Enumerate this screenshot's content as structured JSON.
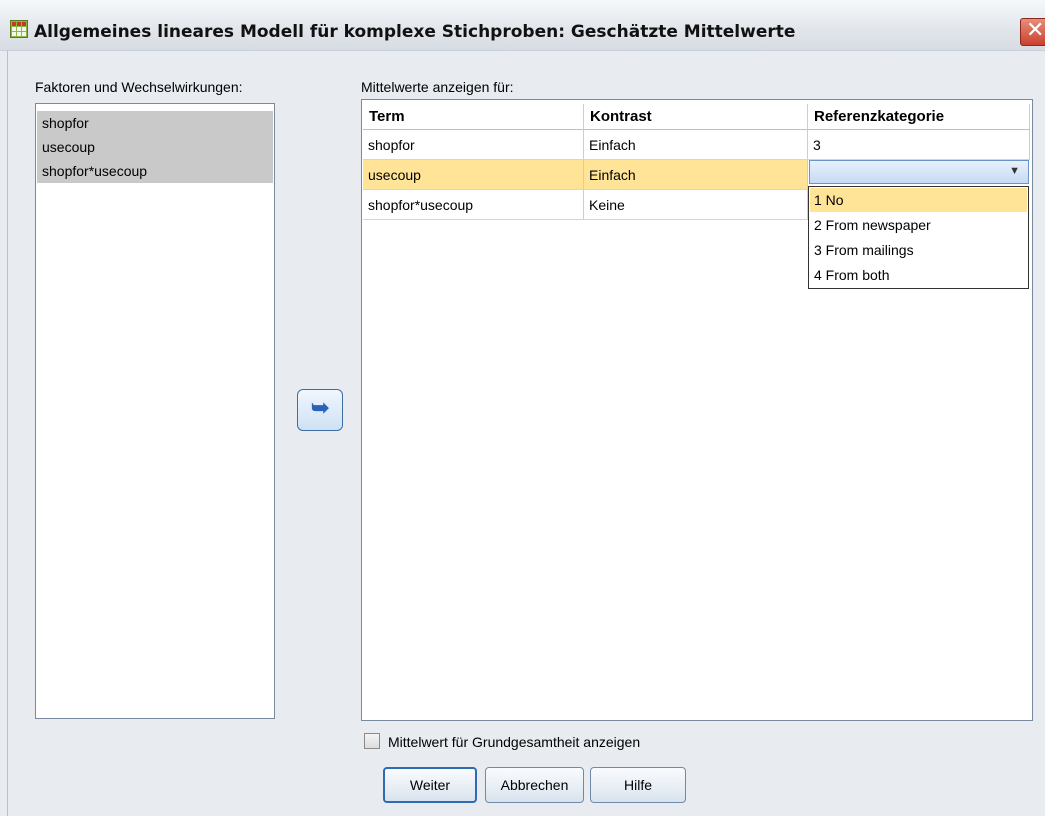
{
  "window": {
    "title": "Allgemeines lineares Modell für komplexe Stichproben: Geschätzte Mittelwerte",
    "close_glyph": "✕"
  },
  "left_panel": {
    "label": "Faktoren und Wechselwirkungen:",
    "items": [
      "shopfor",
      "usecoup",
      "shopfor*usecoup"
    ]
  },
  "move_button": {
    "icon": "move-left-arrow-icon",
    "glyph": "➥"
  },
  "means_panel": {
    "label": "Mittelwerte anzeigen für:",
    "columns": [
      "Term",
      "Kontrast",
      "Referenzkategorie"
    ],
    "rows": [
      {
        "term": "shopfor",
        "contrast": "Einfach",
        "reference": "3"
      },
      {
        "term": "usecoup",
        "contrast": "Einfach",
        "reference": ""
      },
      {
        "term": "shopfor*usecoup",
        "contrast": "Keine",
        "reference": ""
      }
    ],
    "dropdown_options": [
      "1 No",
      "2 From newspaper",
      "3 From mailings",
      "4 From both"
    ],
    "dropdown_highlighted": "1 No"
  },
  "checkbox": {
    "label": "Mittelwert für Grundgesamtheit anzeigen",
    "checked": false
  },
  "buttons": {
    "continue": "Weiter",
    "cancel": "Abbrechen",
    "help": "Hilfe"
  },
  "colors": {
    "selection": "#ffe497",
    "list_selection": "#c9c9c9",
    "accent": "#2f6bb3"
  }
}
